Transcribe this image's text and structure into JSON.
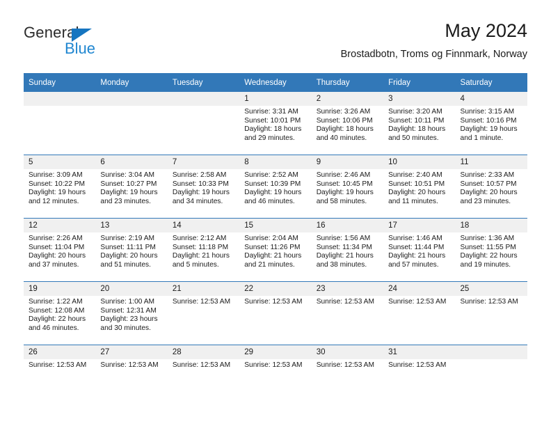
{
  "brand": {
    "name_dark": "General",
    "name_blue": "Blue",
    "accent_color": "#1f86d0",
    "triangle_color": "#1675c0"
  },
  "header": {
    "title": "May 2024",
    "subtitle": "Brostadbotn, Troms og Finnmark, Norway"
  },
  "theme": {
    "header_blue": "#3278b8",
    "daynum_gray": "#f0f0f0",
    "text_color": "#1a1a1a"
  },
  "weekday_headers": [
    "Sunday",
    "Monday",
    "Tuesday",
    "Wednesday",
    "Thursday",
    "Friday",
    "Saturday"
  ],
  "weeks": [
    [
      {
        "day": "",
        "lines": []
      },
      {
        "day": "",
        "lines": []
      },
      {
        "day": "",
        "lines": []
      },
      {
        "day": "1",
        "lines": [
          "Sunrise: 3:31 AM",
          "Sunset: 10:01 PM",
          "Daylight: 18 hours",
          "and 29 minutes."
        ]
      },
      {
        "day": "2",
        "lines": [
          "Sunrise: 3:26 AM",
          "Sunset: 10:06 PM",
          "Daylight: 18 hours",
          "and 40 minutes."
        ]
      },
      {
        "day": "3",
        "lines": [
          "Sunrise: 3:20 AM",
          "Sunset: 10:11 PM",
          "Daylight: 18 hours",
          "and 50 minutes."
        ]
      },
      {
        "day": "4",
        "lines": [
          "Sunrise: 3:15 AM",
          "Sunset: 10:16 PM",
          "Daylight: 19 hours",
          "and 1 minute."
        ]
      }
    ],
    [
      {
        "day": "5",
        "lines": [
          "Sunrise: 3:09 AM",
          "Sunset: 10:22 PM",
          "Daylight: 19 hours",
          "and 12 minutes."
        ]
      },
      {
        "day": "6",
        "lines": [
          "Sunrise: 3:04 AM",
          "Sunset: 10:27 PM",
          "Daylight: 19 hours",
          "and 23 minutes."
        ]
      },
      {
        "day": "7",
        "lines": [
          "Sunrise: 2:58 AM",
          "Sunset: 10:33 PM",
          "Daylight: 19 hours",
          "and 34 minutes."
        ]
      },
      {
        "day": "8",
        "lines": [
          "Sunrise: 2:52 AM",
          "Sunset: 10:39 PM",
          "Daylight: 19 hours",
          "and 46 minutes."
        ]
      },
      {
        "day": "9",
        "lines": [
          "Sunrise: 2:46 AM",
          "Sunset: 10:45 PM",
          "Daylight: 19 hours",
          "and 58 minutes."
        ]
      },
      {
        "day": "10",
        "lines": [
          "Sunrise: 2:40 AM",
          "Sunset: 10:51 PM",
          "Daylight: 20 hours",
          "and 11 minutes."
        ]
      },
      {
        "day": "11",
        "lines": [
          "Sunrise: 2:33 AM",
          "Sunset: 10:57 PM",
          "Daylight: 20 hours",
          "and 23 minutes."
        ]
      }
    ],
    [
      {
        "day": "12",
        "lines": [
          "Sunrise: 2:26 AM",
          "Sunset: 11:04 PM",
          "Daylight: 20 hours",
          "and 37 minutes."
        ]
      },
      {
        "day": "13",
        "lines": [
          "Sunrise: 2:19 AM",
          "Sunset: 11:11 PM",
          "Daylight: 20 hours",
          "and 51 minutes."
        ]
      },
      {
        "day": "14",
        "lines": [
          "Sunrise: 2:12 AM",
          "Sunset: 11:18 PM",
          "Daylight: 21 hours",
          "and 5 minutes."
        ]
      },
      {
        "day": "15",
        "lines": [
          "Sunrise: 2:04 AM",
          "Sunset: 11:26 PM",
          "Daylight: 21 hours",
          "and 21 minutes."
        ]
      },
      {
        "day": "16",
        "lines": [
          "Sunrise: 1:56 AM",
          "Sunset: 11:34 PM",
          "Daylight: 21 hours",
          "and 38 minutes."
        ]
      },
      {
        "day": "17",
        "lines": [
          "Sunrise: 1:46 AM",
          "Sunset: 11:44 PM",
          "Daylight: 21 hours",
          "and 57 minutes."
        ]
      },
      {
        "day": "18",
        "lines": [
          "Sunrise: 1:36 AM",
          "Sunset: 11:55 PM",
          "Daylight: 22 hours",
          "and 19 minutes."
        ]
      }
    ],
    [
      {
        "day": "19",
        "lines": [
          "Sunrise: 1:22 AM",
          "Sunset: 12:08 AM",
          "Daylight: 22 hours",
          "and 46 minutes."
        ]
      },
      {
        "day": "20",
        "lines": [
          "Sunrise: 1:00 AM",
          "Sunset: 12:31 AM",
          "Daylight: 23 hours",
          "and 30 minutes."
        ]
      },
      {
        "day": "21",
        "lines": [
          "Sunrise: 12:53 AM"
        ]
      },
      {
        "day": "22",
        "lines": [
          "Sunrise: 12:53 AM"
        ]
      },
      {
        "day": "23",
        "lines": [
          "Sunrise: 12:53 AM"
        ]
      },
      {
        "day": "24",
        "lines": [
          "Sunrise: 12:53 AM"
        ]
      },
      {
        "day": "25",
        "lines": [
          "Sunrise: 12:53 AM"
        ]
      }
    ],
    [
      {
        "day": "26",
        "lines": [
          "Sunrise: 12:53 AM"
        ]
      },
      {
        "day": "27",
        "lines": [
          "Sunrise: 12:53 AM"
        ]
      },
      {
        "day": "28",
        "lines": [
          "Sunrise: 12:53 AM"
        ]
      },
      {
        "day": "29",
        "lines": [
          "Sunrise: 12:53 AM"
        ]
      },
      {
        "day": "30",
        "lines": [
          "Sunrise: 12:53 AM"
        ]
      },
      {
        "day": "31",
        "lines": [
          "Sunrise: 12:53 AM"
        ]
      },
      {
        "day": "",
        "lines": []
      }
    ]
  ]
}
